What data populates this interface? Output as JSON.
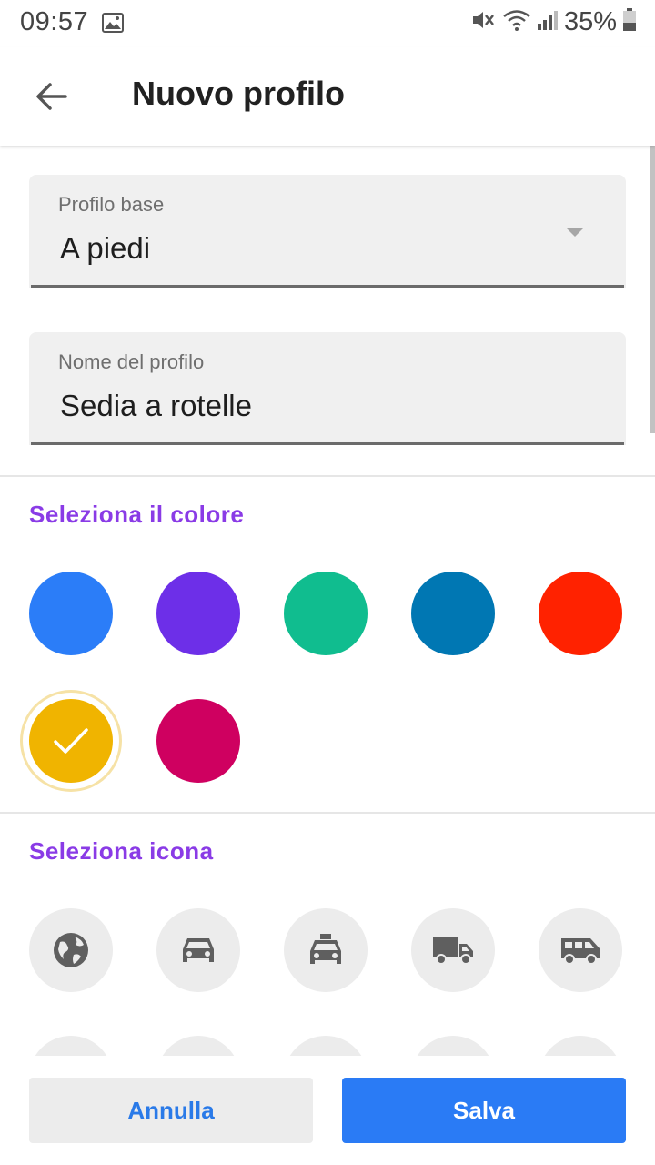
{
  "status_bar": {
    "time": "09:57",
    "battery": "35%"
  },
  "app_bar": {
    "title": "Nuovo profilo"
  },
  "fields": {
    "base_profile": {
      "label": "Profilo base",
      "value": "A piedi"
    },
    "profile_name": {
      "label": "Nome del profilo",
      "value": "Sedia a rotelle"
    }
  },
  "color_section": {
    "title": "Seleziona il colore",
    "colors": [
      "#2b7df8",
      "#6d2fe8",
      "#10bd8f",
      "#0077b3",
      "#ff2200",
      "#f0b400",
      "#cf0060"
    ],
    "selected_index": 5
  },
  "icon_section": {
    "title": "Seleziona icona",
    "icons": [
      "globe-icon",
      "car-icon",
      "taxi-icon",
      "truck-icon",
      "van-icon"
    ]
  },
  "actions": {
    "cancel": "Annulla",
    "save": "Salva"
  }
}
